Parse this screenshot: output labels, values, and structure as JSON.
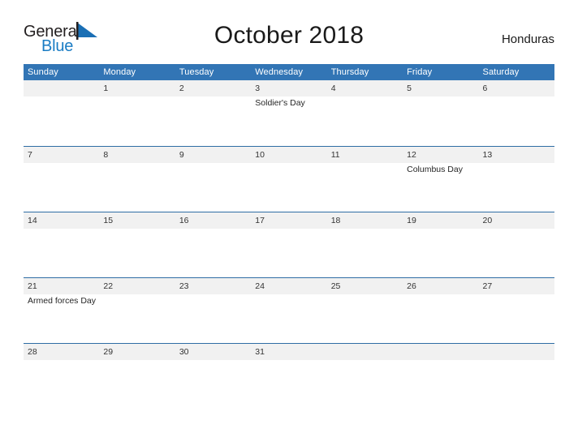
{
  "brand": {
    "name_part1": "General",
    "name_part2": "Blue",
    "flag_color": "#1a6fb5",
    "text_color": "#231f20",
    "blue_color": "#1a7cc4"
  },
  "header": {
    "title": "October 2018",
    "country": "Honduras"
  },
  "theme": {
    "header_blue": "#3275b5",
    "row_border_blue": "#2e6da4",
    "daynum_band": "#f1f1f1",
    "page_background": "#ffffff"
  },
  "calendar": {
    "month": "October",
    "year": "2018",
    "weekday_headers": [
      "Sunday",
      "Monday",
      "Tuesday",
      "Wednesday",
      "Thursday",
      "Friday",
      "Saturday"
    ],
    "weeks": [
      [
        {
          "day": "",
          "event": ""
        },
        {
          "day": "1",
          "event": ""
        },
        {
          "day": "2",
          "event": ""
        },
        {
          "day": "3",
          "event": "Soldier's Day"
        },
        {
          "day": "4",
          "event": ""
        },
        {
          "day": "5",
          "event": ""
        },
        {
          "day": "6",
          "event": ""
        }
      ],
      [
        {
          "day": "7",
          "event": ""
        },
        {
          "day": "8",
          "event": ""
        },
        {
          "day": "9",
          "event": ""
        },
        {
          "day": "10",
          "event": ""
        },
        {
          "day": "11",
          "event": ""
        },
        {
          "day": "12",
          "event": "Columbus Day"
        },
        {
          "day": "13",
          "event": ""
        }
      ],
      [
        {
          "day": "14",
          "event": ""
        },
        {
          "day": "15",
          "event": ""
        },
        {
          "day": "16",
          "event": ""
        },
        {
          "day": "17",
          "event": ""
        },
        {
          "day": "18",
          "event": ""
        },
        {
          "day": "19",
          "event": ""
        },
        {
          "day": "20",
          "event": ""
        }
      ],
      [
        {
          "day": "21",
          "event": "Armed forces Day"
        },
        {
          "day": "22",
          "event": ""
        },
        {
          "day": "23",
          "event": ""
        },
        {
          "day": "24",
          "event": ""
        },
        {
          "day": "25",
          "event": ""
        },
        {
          "day": "26",
          "event": ""
        },
        {
          "day": "27",
          "event": ""
        }
      ],
      [
        {
          "day": "28",
          "event": ""
        },
        {
          "day": "29",
          "event": ""
        },
        {
          "day": "30",
          "event": ""
        },
        {
          "day": "31",
          "event": ""
        },
        {
          "day": "",
          "event": ""
        },
        {
          "day": "",
          "event": ""
        },
        {
          "day": "",
          "event": ""
        }
      ]
    ]
  }
}
